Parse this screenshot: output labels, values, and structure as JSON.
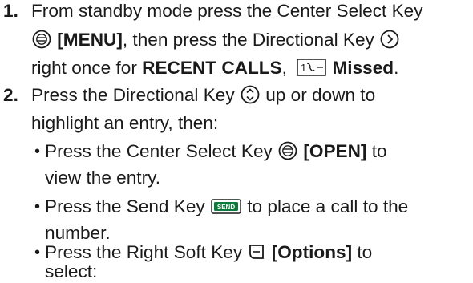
{
  "steps": [
    {
      "number": "1.",
      "lines": [
        {
          "text_a": "From standby mode press the Center Select Key"
        },
        {
          "label_bold": "[MENU]",
          "text_b": ", then press the Directional Key"
        },
        {
          "text_c": "right once for ",
          "bold_1": "RECENT CALLS",
          "sep": ",",
          "bold_2": "Missed",
          "end": "."
        }
      ]
    },
    {
      "number": "2.",
      "lines": [
        {
          "text_a": "Press the Directional Key",
          "text_b": "up or down to"
        },
        {
          "text_c": "highlight an entry, then:"
        }
      ]
    }
  ],
  "bullets": [
    {
      "pre": "Press the Center Select Key",
      "bold": "[OPEN]",
      "post": "to",
      "cont": "view the entry."
    },
    {
      "pre": "Press the Send Key",
      "post": "to place a call to the",
      "cont": "number."
    },
    {
      "pre": "Press the Right Soft Key",
      "bold": "[Options]",
      "post": "to",
      "cont": "select:"
    }
  ],
  "icons": {
    "send_key_label": "SEND",
    "recent_calls_icon_label": "1 ☏",
    "accent_color": "#0b7a3b"
  }
}
